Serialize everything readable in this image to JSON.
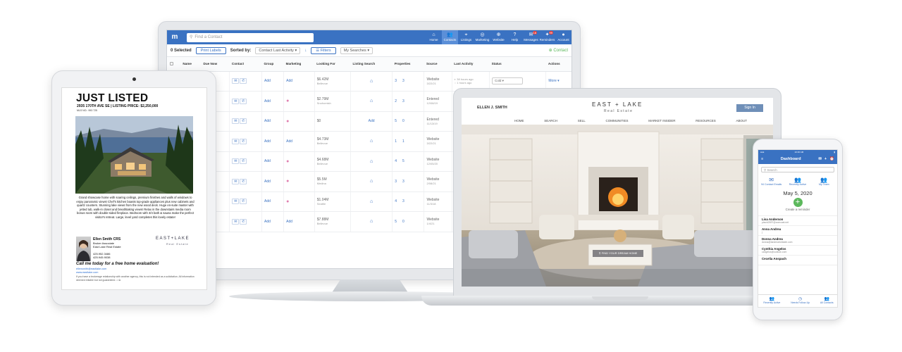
{
  "crm": {
    "search_placeholder": "Find a Contact",
    "nav": [
      {
        "label": "Home",
        "icon": "home-icon"
      },
      {
        "label": "Contacts",
        "icon": "contacts-icon",
        "active": true
      },
      {
        "label": "Listings",
        "icon": "pin-icon"
      },
      {
        "label": "Marketing",
        "icon": "marketing-icon"
      },
      {
        "label": "Website",
        "icon": "globe-icon"
      },
      {
        "label": "Help",
        "icon": "help-icon"
      },
      {
        "label": "Messages",
        "icon": "mail-icon",
        "badge": "18"
      },
      {
        "label": "Reminders",
        "icon": "bell-icon",
        "badge": "99"
      },
      {
        "label": "Account",
        "icon": "account-icon"
      }
    ],
    "selected": "0 Selected",
    "print_labels": "Print Labels",
    "sorted_by": "Sorted by:",
    "sort_value": "Contact Last Activity",
    "filters": "Filters",
    "my_searches": "My Searches",
    "add_contact": "Contact",
    "columns": [
      "Name",
      "Due Now",
      "Contact",
      "Group",
      "Marketing",
      "Looking For",
      "Listing Search",
      "Properties",
      "Source",
      "Last Activity",
      "Status",
      "Actions"
    ],
    "rows": [
      {
        "due": "alarm",
        "group": "Add",
        "marketing": "Add",
        "price": "$6.42M",
        "area": "Bellevue",
        "search": "home",
        "p1": "3",
        "p2": "3",
        "source": "Website",
        "src_date": "3/22/21",
        "activity1": "38 hours ago",
        "activity2": "1 hours ago",
        "status": "Cold",
        "more": "More"
      },
      {
        "due": "alarm",
        "group": "Add",
        "marketing": "drop",
        "price": "$2.79M",
        "area": "Snohomish",
        "search": "home",
        "p1": "2",
        "p2": "3",
        "source": "Entered",
        "src_date": "12/08/19"
      },
      {
        "due": "task",
        "group": "Add",
        "marketing": "drop",
        "price": "$0",
        "area": "",
        "search": "Add",
        "p1": "5",
        "p2": "0",
        "source": "Entered",
        "src_date": "11/13/19"
      },
      {
        "due": "alarm",
        "group": "Add",
        "marketing": "Add",
        "price": "$4.73M",
        "area": "Bellevue",
        "search": "home",
        "p1": "1",
        "p2": "1",
        "source": "Website",
        "src_date": "3/22/21"
      },
      {
        "due": "task",
        "group": "Add",
        "marketing": "drop",
        "price": "$4.68M",
        "area": "Bellevue",
        "search": "home",
        "p1": "4",
        "p2": "5",
        "source": "Website",
        "src_date": "12/05/20"
      },
      {
        "due": "alarm",
        "group": "Add",
        "marketing": "drop",
        "price": "$5.5M",
        "area": "Medina",
        "search": "home",
        "p1": "3",
        "p2": "3",
        "source": "Website",
        "src_date": "2/08/21"
      },
      {
        "due": "task",
        "group": "Add",
        "marketing": "drop",
        "price": "$1.04M",
        "area": "Seattle",
        "search": "home",
        "p1": "4",
        "p2": "3",
        "source": "Website",
        "src_date": "11/3/18"
      },
      {
        "due": "Add",
        "group": "Add",
        "marketing": "Add",
        "price": "$7.88M",
        "area": "Bellevue",
        "search": "home",
        "p1": "5",
        "p2": "0",
        "source": "Website",
        "src_date": "1/4/21"
      }
    ]
  },
  "flyer": {
    "title": "JUST LISTED",
    "address": "2935 170TH AVE SE | LISTING PRICE: $2,250,000",
    "mls": "MLS NO.: 993 725",
    "description": "Grand showcase home with soaring ceilings, premium finishes and walls of windows to enjoy panoramic views! Chef's kitchen boasts top-grade appliances plus new cabinets and quartz counters. Stunning lake views from the new wood deck. Huge en-suite master with jetted tub, walk-in closet and breathtaking views! Relax in the downstairs media room bonus room with double-sided fireplace. Bedroom with 3/4 bath & sauna make the perfect visitor's retreat. Large, level yard completes this lovely estate!",
    "agent_name": "Ellen Smith CRS",
    "agent_role": "Broker Associate",
    "agent_company": "East Lake Real Estate",
    "phone1": "425.952.3486",
    "phone2": "425.945.9038",
    "brand": "EAST+LAKE",
    "brand_sub": "Real Estate",
    "cta": "Call me today for a free home evaluation!",
    "email": "ellensmith@eastlake.com",
    "web": "www.eastlake.com",
    "disclaimer": "If you have a brokerage relationship with another agency, this is not intended as a solicitation. All information deemed reliable but not guaranteed."
  },
  "website": {
    "agent": "ELLEN J. SMITH",
    "logo": "EAST + LAKE",
    "logo_sub": "Real Estate",
    "sign_in": "Sign In",
    "menu": [
      "HOME",
      "SEARCH",
      "SELL",
      "COMMUNITIES",
      "MARKET INSIDER",
      "RESOURCES",
      "ABOUT"
    ],
    "find_home": "FIND YOUR DREAM HOME"
  },
  "phone": {
    "time": "10:46 AM",
    "title": "Dashboard",
    "search": "Search",
    "tiles": [
      {
        "label": "94 Contact Emails",
        "icon": "mail-icon"
      },
      {
        "label": "Recently Active",
        "icon": "contacts-icon"
      },
      {
        "label": "My Team",
        "icon": "team-icon"
      }
    ],
    "date": "May 5, 2020",
    "create_reminder": "Create a reminder",
    "contacts": [
      {
        "first": "Lisa",
        "last": "Anderson",
        "email": "placid2697@comcast.net"
      },
      {
        "first": "Anna",
        "last": "Andrea",
        "email": "j"
      },
      {
        "first": "Donna",
        "last": "Andrea",
        "email": "donna@landmarkestate.com"
      },
      {
        "first": "Cynthia",
        "last": "Angelos",
        "email": "cangelos@outlook.com"
      },
      {
        "first": "Cecelia",
        "last": "Anspach",
        "email": ""
      }
    ],
    "tabs": [
      "Recently Active",
      "Needs Follow-Up",
      "All Contacts"
    ]
  }
}
